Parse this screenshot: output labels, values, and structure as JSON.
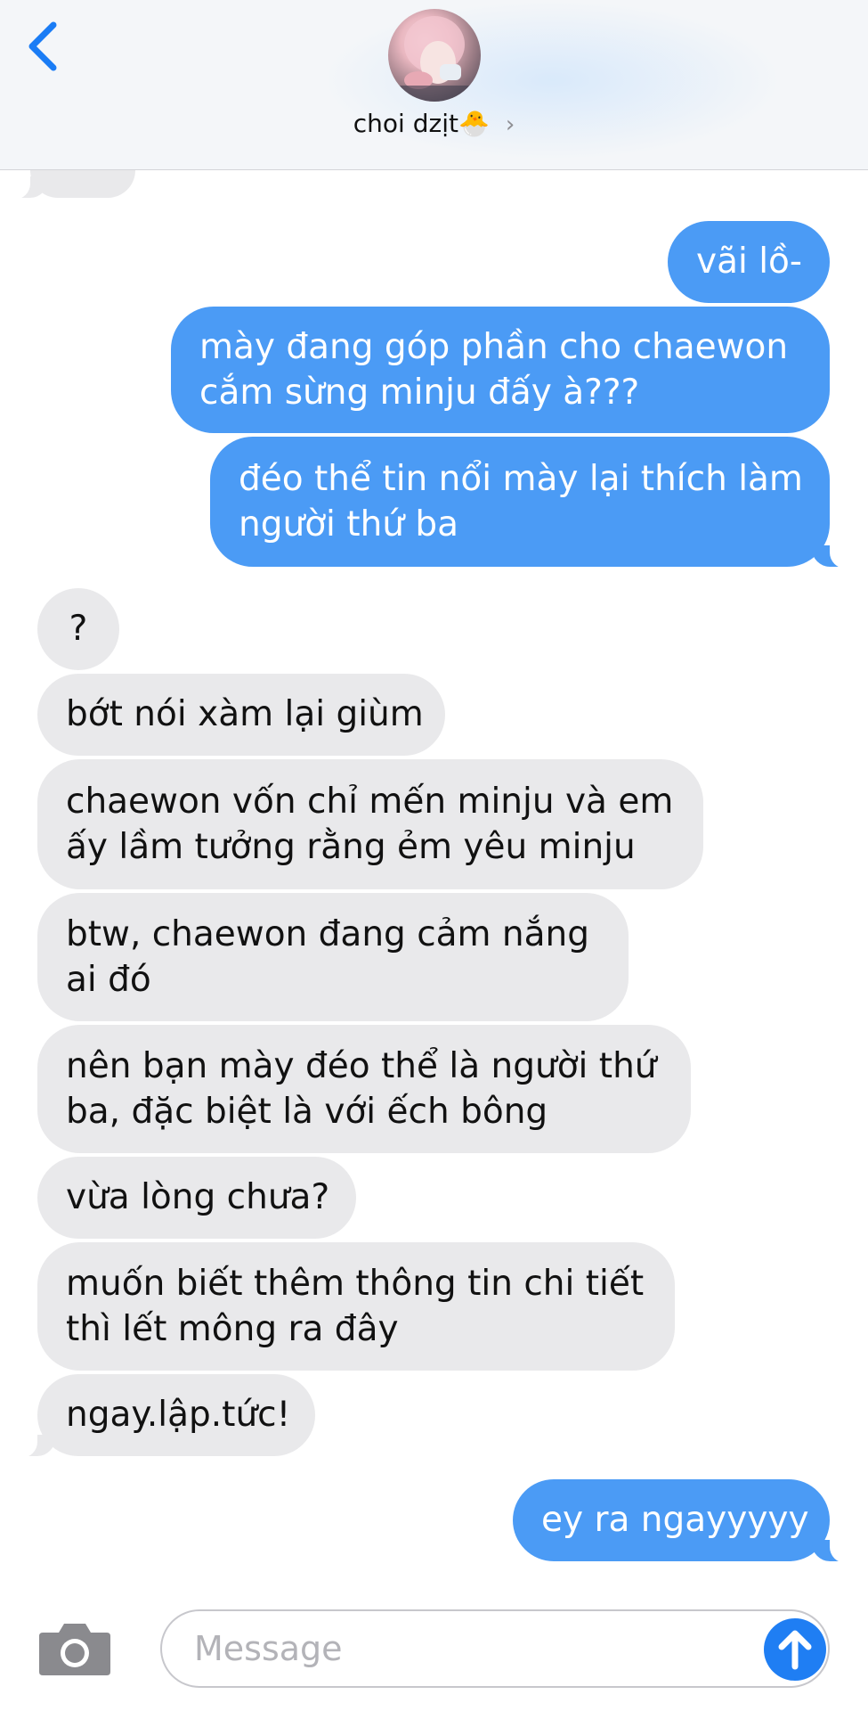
{
  "header": {
    "contact_name": "choi dzịt🐣",
    "chevron": "›"
  },
  "messages": {
    "out1": "vãi lồ-",
    "out2_l1": "mày đang góp phần cho chaewon",
    "out2_l2": "cắm sừng minju đấy à???",
    "out3_l1": "đéo thể tin nổi mày lại thích làm",
    "out3_l2": "người thứ ba",
    "in1": "?",
    "in2": "bớt nói xàm lại giùm",
    "in3_l1": "chaewon vốn chỉ mến minju và em",
    "in3_l2": "ấy lầm tưởng rằng ẻm yêu minju",
    "in4_l1": "btw, chaewon đang cảm nắng",
    "in4_l2": "ai đó",
    "in5_l1": "nên bạn mày đéo thể là người thứ",
    "in5_l2": "ba, đặc biệt là với ếch bông",
    "in6": "vừa lòng chưa?",
    "in7_l1": "muốn biết thêm thông tin chi tiết",
    "in7_l2": "thì lết mông ra đây",
    "in8": "ngay.lập.tức!",
    "out4": "ey ra ngayyyyy"
  },
  "composer": {
    "placeholder": "Message"
  },
  "icons": {
    "back": "chevron-left-icon",
    "camera": "camera-icon",
    "send": "arrow-up-icon"
  },
  "colors": {
    "outgoing": "#4b9bf5",
    "incoming": "#e9e9eb",
    "accent": "#1f7ef3"
  }
}
